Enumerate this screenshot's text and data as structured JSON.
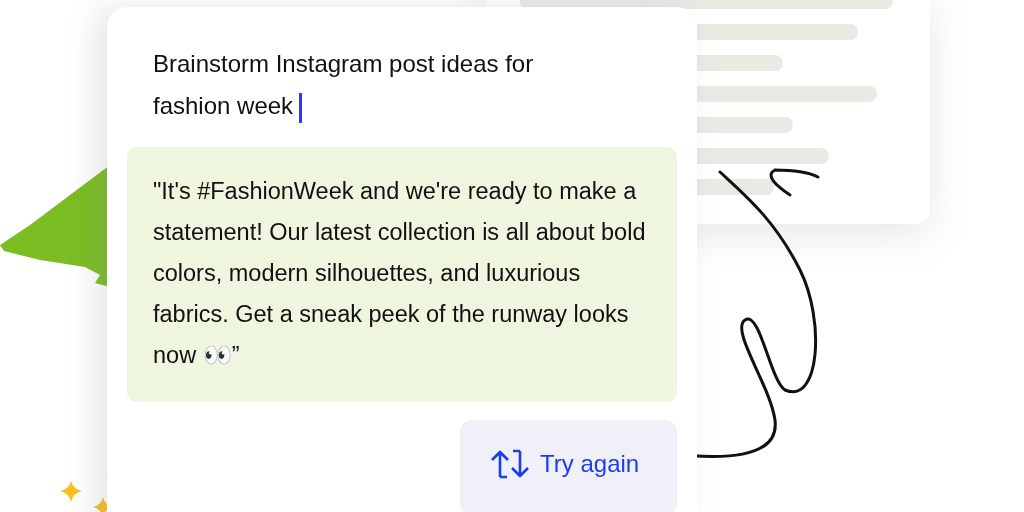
{
  "prompt": {
    "value": "Brainstorm Instagram post ideas for fashion week"
  },
  "response": {
    "text": "\"It's #FashionWeek and we're ready to make a statement! Our latest collection is all about bold colors, modern silhouettes, and luxurious fabrics. Get a sneak peek of the runway looks now 👀”"
  },
  "action": {
    "label": "Try again"
  }
}
